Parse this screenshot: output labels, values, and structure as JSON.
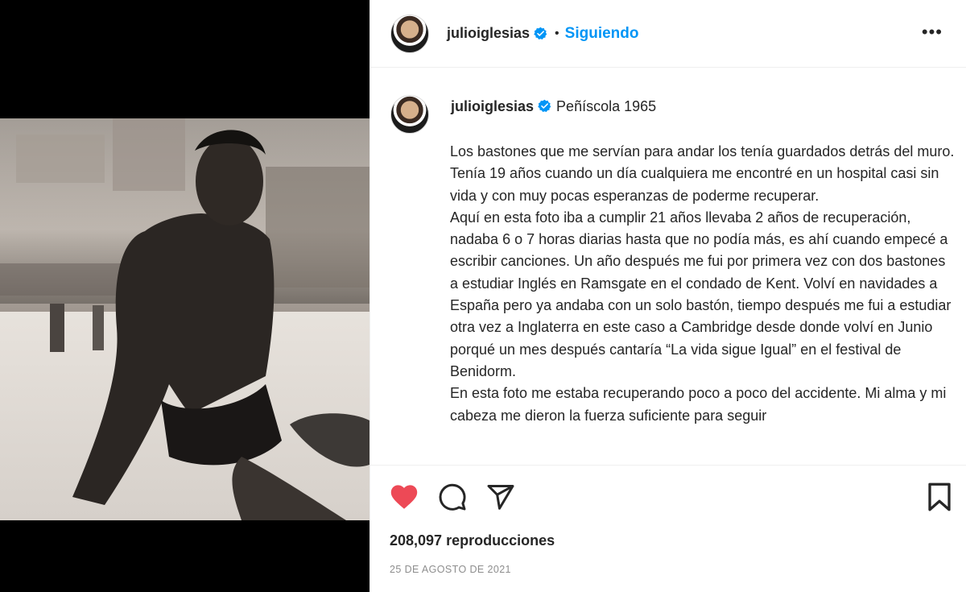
{
  "post": {
    "username": "julioiglesias",
    "follow_status": "Siguiendo",
    "separator": "•",
    "more_label": "•••"
  },
  "caption": {
    "username": "julioiglesias",
    "location": "Peñíscola 1965",
    "text": "Los bastones que me servían para andar los tenía guardados detrás del muro.\nTenía 19 años cuando un día cualquiera me encontré en un hospital casi sin vida y con muy pocas esperanzas de poderme recuperar.\nAquí en esta foto iba a cumplir 21 años llevaba 2 años de recuperación, nadaba 6 o 7 horas diarias hasta que no podía más, es ahí cuando empecé a escribir canciones. Un año después me fui por primera vez con dos bastones a estudiar Inglés en Ramsgate en el condado de Kent. Volví en navidades a España pero ya andaba con un solo bastón, tiempo después me fui a estudiar otra vez a Inglaterra en este caso a Cambridge desde donde volví en Junio porqué un mes después cantaría “La vida sigue Igual” en el festival de Benidorm.\nEn esta foto me estaba recuperando poco a poco del accidente. Mi alma y mi cabeza me dieron la fuerza suficiente para seguir"
  },
  "stats": {
    "views": "208,097 reproducciones",
    "date": "25 DE AGOSTO DE 2021"
  },
  "icons": {
    "like": "heart-icon",
    "comment": "comment-icon",
    "share": "share-icon",
    "save": "bookmark-icon",
    "verified": "verified-badge-icon",
    "more": "more-options-icon"
  },
  "state": {
    "liked": true,
    "verified": true
  },
  "colors": {
    "like": "#ed4956",
    "accent": "#0095f6",
    "text": "#262626",
    "muted": "#8e8e8e",
    "media_bg": "#000000"
  }
}
